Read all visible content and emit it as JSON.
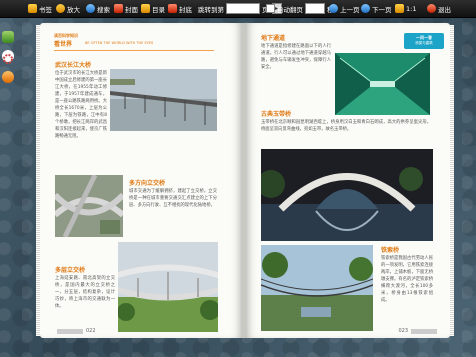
{
  "toolbar": {
    "bookmark_label": "书签",
    "zoom_label": "放大",
    "search_label": "搜索",
    "cover_label": "封面",
    "toc_label": "目录",
    "back_cover_label": "封底",
    "goto_label": "跳转到第",
    "page_unit": "页",
    "autoflip_label": "自动翻页",
    "seconds_unit": "秒",
    "prev_label": "上一页",
    "next_label": "下一页",
    "ratio_label": "1:1",
    "exit_label": "退出"
  },
  "book": {
    "left": {
      "header_cn": "读百科学知识",
      "header_en": "BE OFTEN THE WORLD WITH THE EYES",
      "header_cn2": "看世界",
      "sections": [
        {
          "title": "武汉长江大桥",
          "body": "位于武汉市的长江大桥是新中国成立后修建的第一座长江大桥，在1955年动工修建，于1957年建成通车，是一座公路铁路两用桥。大桥全长1670米，上层为公路，下层为铁路，江中有8个桥墩，把长江两岸的武昌和汉阳连接起来，使京广铁路畅通无阻。"
        },
        {
          "title": "多方向立交桥",
          "body": "城市交通为了缓解拥挤，建起了立交桥。立交桥是一种在城市重要交通交汇点建立的上下分层、多方向行驶、互不相扰的现代化陆地桥。"
        },
        {
          "title": "多层立交桥",
          "body": "上海延安路、南北高架的立交桥，是国内最大的立交桥之一，分五层，结构复杂，设计巧妙，将上海市的交通联为一体。"
        }
      ],
      "page_number": "022"
    },
    "right": {
      "header_label": "一问一答",
      "header_sub": "桥梁与建筑",
      "sections": [
        {
          "title": "地下通道",
          "body": "地下通道是指修建在路面以下的人行通道，行人可以通过地下通道穿越马路，避免与车辆发生冲突，保障行人安全。"
        },
        {
          "title": "古典玉带桥",
          "body": "玉带桥在北京颐和园昆明湖西堤上，桥身用汉白玉和青白石砌成，高大的拱券呈蛋尖形，桥面呈双向反弯曲线，宛如玉带，故名玉带桥。"
        },
        {
          "title": "铁索桥",
          "body": "铁索桥是我国古代劳动人民的一项发明，它用铁索连接两岸，上铺木板，下面无桥墩支撑。有名的泸定铁索桥横跨大渡河，全长100多米，桥身由13根铁索组成。"
        }
      ],
      "page_number": "023"
    }
  }
}
